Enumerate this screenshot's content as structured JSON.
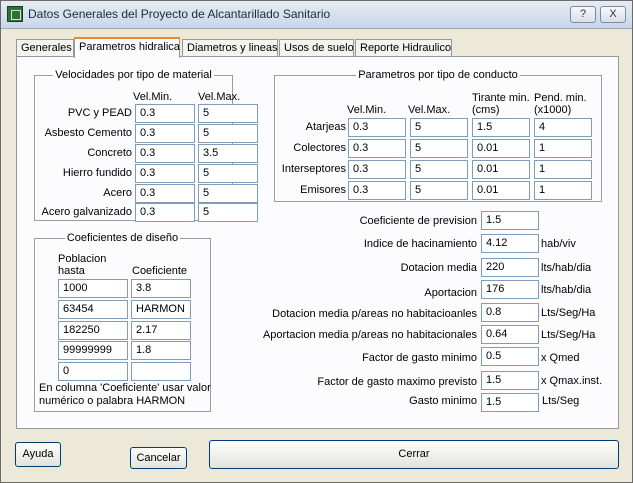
{
  "window": {
    "title": "Datos Generales del Proyecto de Alcantarillado Sanitario",
    "help_btn": "?",
    "close_btn": "X"
  },
  "tabs": [
    {
      "label": "Generales"
    },
    {
      "label": "Parametros hidralica",
      "active": true
    },
    {
      "label": "Diametros y lineas"
    },
    {
      "label": "Usos de suelo"
    },
    {
      "label": "Reporte Hidraulico"
    }
  ],
  "velocidades": {
    "title": "Velocidades por tipo de material",
    "col_min": "Vel.Min.",
    "col_max": "Vel.Max.",
    "rows": [
      {
        "label": "PVC y PEAD",
        "min": "0.3",
        "max": "5"
      },
      {
        "label": "Asbesto Cemento",
        "min": "0.3",
        "max": "5"
      },
      {
        "label": "Concreto",
        "min": "0.3",
        "max": "3.5"
      },
      {
        "label": "Hierro fundido",
        "min": "0.3",
        "max": "5"
      },
      {
        "label": "Acero",
        "min": "0.3",
        "max": "5"
      },
      {
        "label": "Acero galvanizado",
        "min": "0.3",
        "max": "5"
      }
    ]
  },
  "conducto": {
    "title": "Parametros por tipo de conducto",
    "col_min": "Vel.Min.",
    "col_max": "Vel.Max.",
    "col_tirante_1": "Tirante min.",
    "col_tirante_2": "(cms)",
    "col_pend_1": "Pend. min.",
    "col_pend_2": "(x1000)",
    "rows": [
      {
        "label": "Atarjeas",
        "min": "0.3",
        "max": "5",
        "tirante": "1.5",
        "pend": "4"
      },
      {
        "label": "Colectores",
        "min": "0.3",
        "max": "5",
        "tirante": "0.01",
        "pend": "1"
      },
      {
        "label": "Interseptores",
        "min": "0.3",
        "max": "5",
        "tirante": "0.01",
        "pend": "1"
      },
      {
        "label": "Emisores",
        "min": "0.3",
        "max": "5",
        "tirante": "0.01",
        "pend": "1"
      }
    ]
  },
  "coeficientes": {
    "title": "Coeficientes de diseño",
    "col_pob_1": "Poblacion",
    "col_pob_2": "hasta",
    "col_coef": "Coeficiente",
    "rows": [
      {
        "pob": "1000",
        "coef": "3.8"
      },
      {
        "pob": "63454",
        "coef": "HARMON"
      },
      {
        "pob": "182250",
        "coef": "2.17"
      },
      {
        "pob": "99999999",
        "coef": "1.8"
      },
      {
        "pob": "0",
        "coef": ""
      }
    ],
    "note_1": "En columna 'Coeficiente' usar valor",
    "note_2": "numérico o palabra HARMON"
  },
  "params": [
    {
      "label": "Coeficiente de prevision",
      "value": "1.5",
      "unit": ""
    },
    {
      "label": "Indice de hacinamiento",
      "value": "4.12",
      "unit": "hab/viv"
    },
    {
      "label": "Dotacion media",
      "value": "220",
      "unit": "lts/hab/dia"
    },
    {
      "label": "Aportacion",
      "value": "176",
      "unit": "lts/hab/dia"
    },
    {
      "label": "Dotacion media p/areas no habitacioanles",
      "value": "0.8",
      "unit": "Lts/Seg/Ha"
    },
    {
      "label": "Aportacion media p/areas no habitacionales",
      "value": "0.64",
      "unit": "Lts/Seg/Ha"
    },
    {
      "label": "Factor de gasto minimo",
      "value": "0.5",
      "unit": "x Qmed"
    },
    {
      "label": "Factor de gasto maximo previsto",
      "value": "1.5",
      "unit": "x Qmax.inst."
    },
    {
      "label": "Gasto minimo",
      "value": "1.5",
      "unit": "Lts/Seg"
    }
  ],
  "buttons": {
    "ayuda": "Ayuda",
    "cancelar": "Cancelar",
    "cerrar": "Cerrar"
  }
}
